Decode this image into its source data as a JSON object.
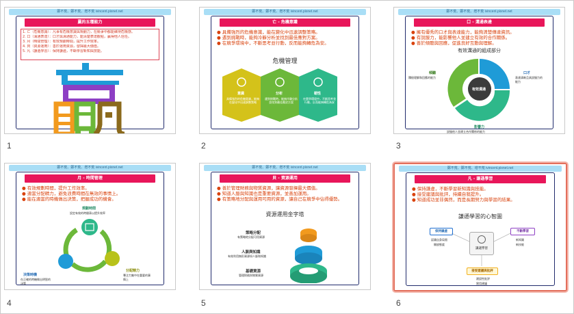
{
  "header_text": "鄭不荒、鄭不荒、增不荒 ivincent.pixnet.net",
  "slides": [
    {
      "number": "1",
      "banner": "贏的五種能力",
      "bullets": [
        "1. 亡（危機意識）：凡事有危機意識與規劃力，在競爭中都能維持危機感。",
        "2. 口（溝通表達）：口才與溝通能力，能清楚表達觀點，贏得他人信任。",
        "3. 月（時間管理）：有效規劃時間，提升工作效率。",
        "4. 貝（資源運用）：善於運用資源，發揮最大價值。",
        "5. 凡（謙遜學習）：保持謙遜，不斷學習新知與技能。"
      ],
      "big_char": "贏"
    },
    {
      "number": "2",
      "banner": "亡 - 危機意識",
      "bullets": [
        "具備強烈的危機意識，能在變化中迅速調整策略。",
        "遇到挑戰時，能夠冷靜分析並找到最佳應對方案。",
        "在競爭環境中，不斷思考並行動，反而能夠轉危為安。"
      ],
      "diagram_title": "危機管理",
      "items": [
        {
          "name": "意識",
          "text": "具備強烈的危機意識，能夠在變化中迅速調整策略"
        },
        {
          "name": "分析",
          "text": "遇到挑戰時，能夠冷靜分析並找到最佳應對方案"
        },
        {
          "name": "韌性",
          "text": "在競爭環境中，不斷思考並行動，反而能夠轉危為安"
        }
      ]
    },
    {
      "number": "3",
      "banner": "口 - 溝通表達",
      "bullets": [
        "擁有優秀的口才與表達能力，能夠清楚傳達資訊。",
        "有說服力，能影響他人並建立有效的合作關係。",
        "善於傾聽與回應，促進良好互動與理解。"
      ],
      "diagram_title": "有效溝通的組成部分",
      "center": "有效溝通",
      "parts": [
        {
          "name": "口才",
          "text": "表達清晰且具說服力的能力"
        },
        {
          "name": "傾聽",
          "text": "積極理解和回應的能力"
        },
        {
          "name": "影響力",
          "text": "說服他人並建立合作關係的能力"
        }
      ]
    },
    {
      "number": "4",
      "banner": "月 - 時間管理",
      "bullets": [
        "有效規劃時間，提升工作效率。",
        "適當分配精力，避免浪費時間在無效的事情上。",
        "能在適當的時機做出決策，把握成功的機會。"
      ],
      "cycle": [
        {
          "name": "規劃時間",
          "text": "設定有效的時間表以提升效率"
        },
        {
          "name": "分配精力",
          "text": "專注力集中在重要的事情上"
        },
        {
          "name": "決策時機",
          "text": "在正確的時機做出明智的決策"
        }
      ]
    },
    {
      "number": "5",
      "banner": "貝 - 資源運用",
      "bullets": [
        "善於管理財務與物質資源，讓資源發揮最大價值。",
        "知道人脈與知識也是重要資源，並善加運用。",
        "有策略地分配與運用可用的資源，讓自己在競爭中佔得優勢。"
      ],
      "diagram_title": "資源運用金字塔",
      "layers": [
        {
          "name": "策略分配",
          "text": "有策略地分配可用資源"
        },
        {
          "name": "人脈與知識",
          "text": "有效利用無形資源如人脈和知識"
        },
        {
          "name": "基礎資源",
          "text": "管理財務與物質資源"
        }
      ]
    },
    {
      "number": "6",
      "banner": "凡 - 謙遜學習",
      "bullets": [
        "保持謙虛，不斷學習新知識與技能。",
        "接受建議與批評，持續自我提升。",
        "知道成功並非偶然，而是長期努力與學習的結果。"
      ],
      "diagram_title": "謙遜學習的心智圖",
      "center": "謙遜學習",
      "branches": [
        {
          "name": "保持謙虛",
          "items": [
            "認識自身局限",
            "開放態度"
          ]
        },
        {
          "name": "不斷學習",
          "items": [
            "新知識",
            "新技能"
          ]
        },
        {
          "name": "接受建議與批評",
          "items": [
            "建設性批評",
            "實用建議"
          ]
        }
      ]
    }
  ],
  "colors": {
    "banner": "#e8165a",
    "bullet_text": "#d9430e",
    "selected_border": "#e36f5c",
    "yellow": "#d4c21a",
    "green": "#6cb83a",
    "teal": "#2eb88a",
    "blue": "#1f9bd7",
    "orange": "#f29a1e",
    "purple": "#8d3fc4"
  }
}
